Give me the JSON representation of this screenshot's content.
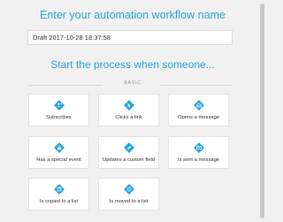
{
  "workflow_name": {
    "heading": "Enter your automation workflow name",
    "value": "Draft 2017-10-28 18:37:58"
  },
  "trigger_heading": "Start the process when someone...",
  "section_label": "BASIC",
  "accent_color": "#2aa4df",
  "triggers": [
    {
      "label": "Subscribes",
      "icon": "subscribe-icon"
    },
    {
      "label": "Clicks a link",
      "icon": "click-icon"
    },
    {
      "label": "Opens a message",
      "icon": "open-message-icon"
    },
    {
      "label": "Has a special event",
      "icon": "event-icon"
    },
    {
      "label": "Updates a custom field",
      "icon": "edit-field-icon"
    },
    {
      "label": "Is sent a message",
      "icon": "send-message-icon"
    },
    {
      "label": "Is copied to a list",
      "icon": "copy-list-icon"
    },
    {
      "label": "Is moved to a list",
      "icon": "move-list-icon"
    }
  ]
}
